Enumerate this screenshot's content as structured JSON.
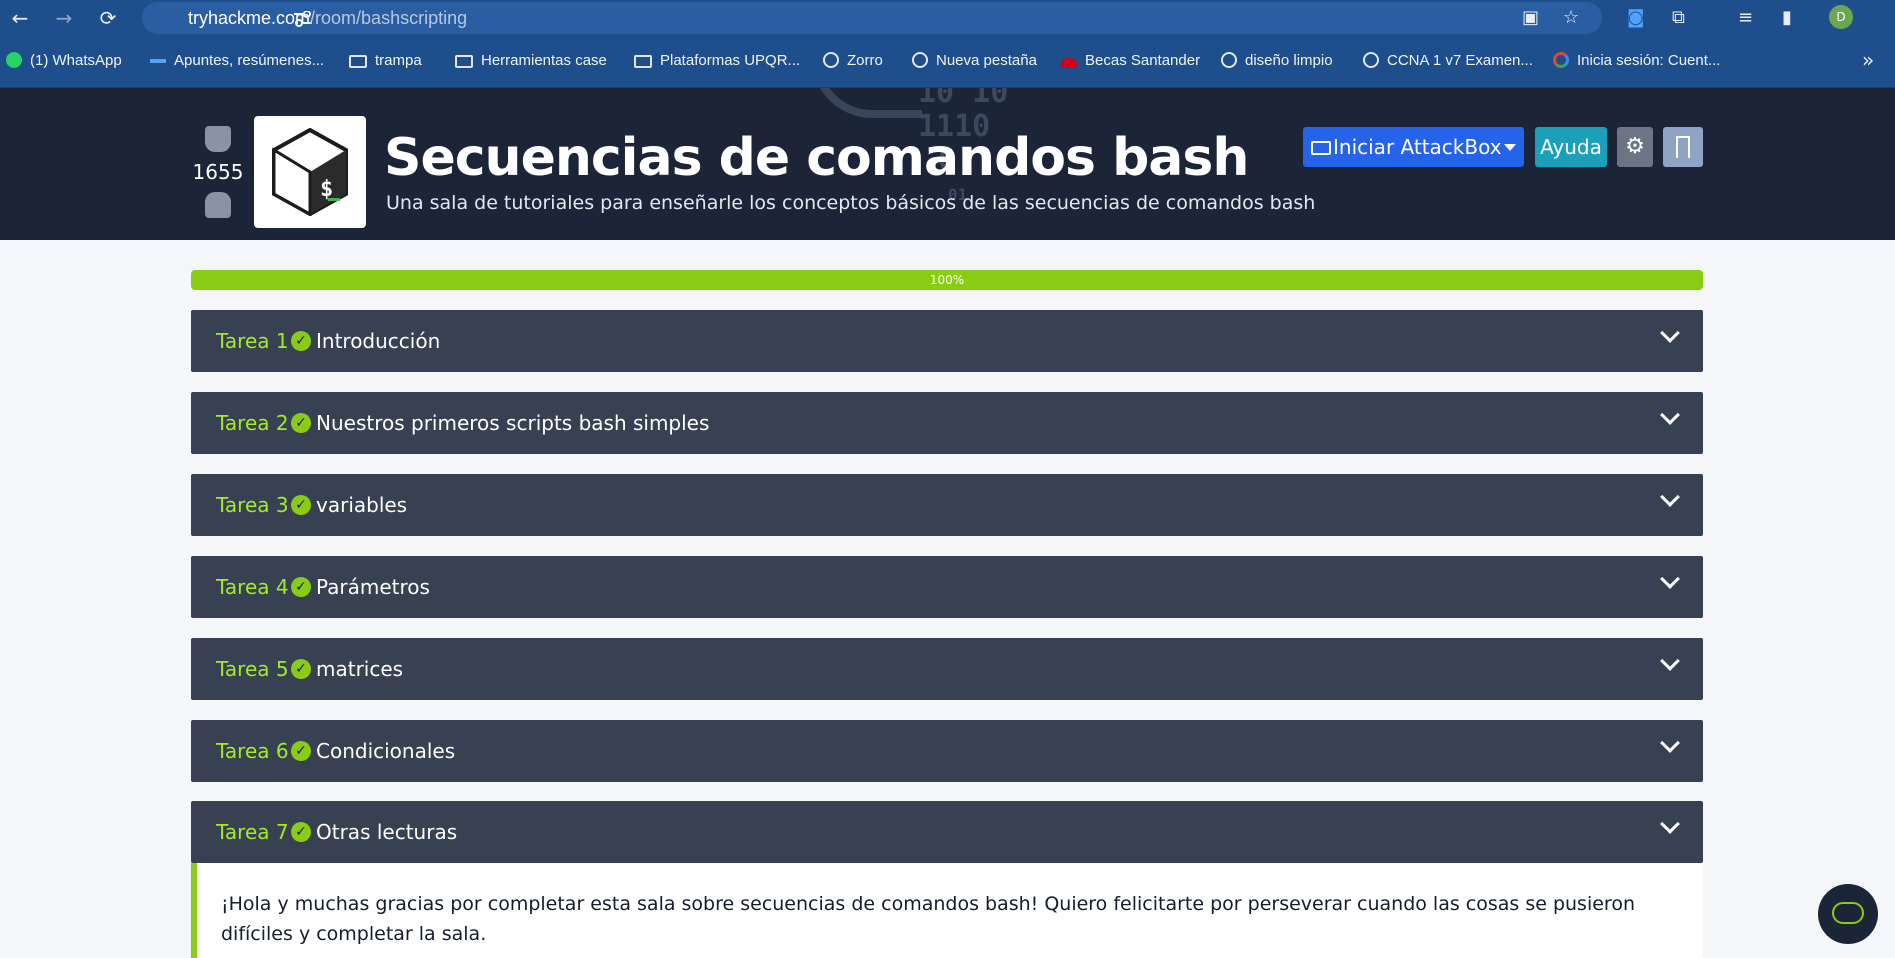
{
  "browser": {
    "url_domain": "tryhackme.com",
    "url_path": "/room/bashscripting",
    "avatar_letter": "D"
  },
  "bookmarks": [
    {
      "label": "(1) WhatsApp",
      "icon": "whatsapp-icon"
    },
    {
      "label": "Apuntes, resúmenes...",
      "icon": "bookmark-icon"
    },
    {
      "label": "trampa",
      "icon": "folder-icon"
    },
    {
      "label": "Herramientas case",
      "icon": "folder-icon"
    },
    {
      "label": "Plataformas UPQR...",
      "icon": "folder-icon"
    },
    {
      "label": "Zorro",
      "icon": "globe-icon"
    },
    {
      "label": "Nueva pestaña",
      "icon": "globe-icon"
    },
    {
      "label": "Becas Santander",
      "icon": "santander-icon"
    },
    {
      "label": "diseño limpio",
      "icon": "chrome-icon"
    },
    {
      "label": "CCNA 1 v7 Examen...",
      "icon": "globe-icon"
    },
    {
      "label": "Inicia sesión: Cuent...",
      "icon": "google-icon"
    }
  ],
  "room": {
    "votes": "1655",
    "title": "Secuencias de comandos bash",
    "subtitle": "Una sala de tutoriales para enseñarle los conceptos básicos de las secuencias de comandos bash",
    "attackbox_label": "Iniciar AttackBox",
    "help_label": "Ayuda",
    "bg_digits": [
      "10  10",
      "1110",
      "0",
      "01"
    ]
  },
  "progress": {
    "value": 1.0,
    "label": "100%",
    "color": "#88cc14"
  },
  "tasks": [
    {
      "num": "Tarea 1",
      "title": "Introducción"
    },
    {
      "num": "Tarea 2",
      "title": "Nuestros primeros scripts bash simples"
    },
    {
      "num": "Tarea 3",
      "title": "variables"
    },
    {
      "num": "Tarea 4",
      "title": "Parámetros"
    },
    {
      "num": "Tarea 5",
      "title": "matrices"
    },
    {
      "num": "Tarea 6",
      "title": "Condicionales"
    },
    {
      "num": "Tarea 7",
      "title": "Otras lecturas"
    }
  ],
  "task7_body": "¡Hola y muchas gracias por completar esta sala sobre secuencias de comandos bash! Quiero felicitarte por perseverar cuando las cosas se pusieron difíciles y completar la sala.",
  "colors": {
    "accent_green": "#88cc14",
    "header_bg": "#1c2538",
    "task_bg": "#384152",
    "attack_blue": "#2563eb",
    "help_teal": "#1aa0b8"
  }
}
